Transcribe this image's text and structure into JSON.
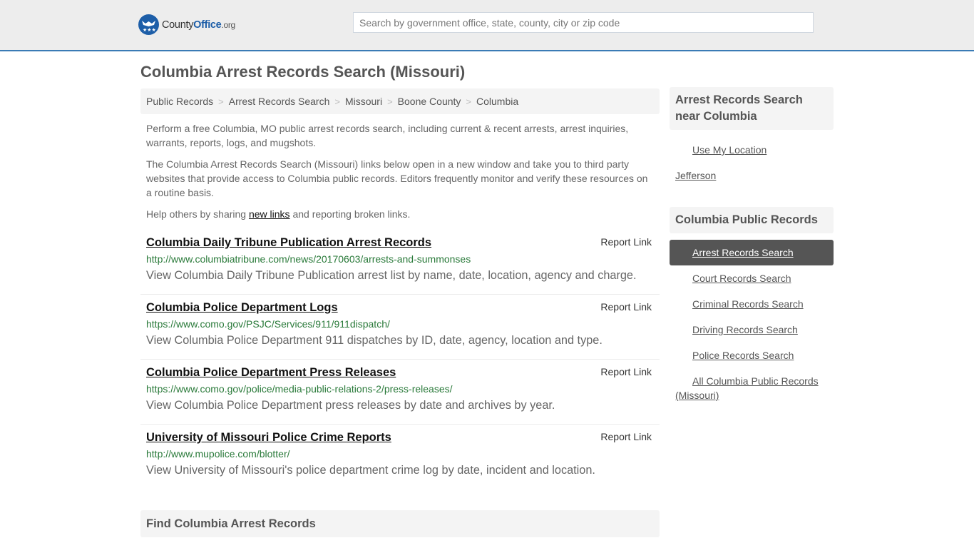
{
  "header": {
    "logo": {
      "county": "County",
      "office": "Office",
      "org": ".org",
      "icon": "eagle-stars-icon",
      "brand_color": "#1d5ea8"
    },
    "search_placeholder": "Search by government office, state, county, city or zip code",
    "accent_color": "#3a7bb5"
  },
  "page_title": "Columbia Arrest Records Search (Missouri)",
  "breadcrumb": [
    {
      "label": "Public Records"
    },
    {
      "label": "Arrest Records Search"
    },
    {
      "label": "Missouri"
    },
    {
      "label": "Boone County"
    },
    {
      "label": "Columbia"
    }
  ],
  "breadcrumb_separator": ">",
  "intro": {
    "p1": "Perform a free Columbia, MO public arrest records search, including current & recent arrests, arrest inquiries, warrants, reports, logs, and mugshots.",
    "p2": "The Columbia Arrest Records Search (Missouri) links below open in a new window and take you to third party websites that provide access to Columbia public records. Editors frequently monitor and verify these resources on a routine basis.",
    "p3_before": "Help others by sharing ",
    "p3_link": "new links",
    "p3_after": " and reporting broken links."
  },
  "links": [
    {
      "title": "Columbia Daily Tribune Publication Arrest Records",
      "report": "Report Link",
      "url": "http://www.columbiatribune.com/news/20170603/arrests-and-summonses",
      "desc": "View Columbia Daily Tribune Publication arrest list by name, date, location, agency and charge."
    },
    {
      "title": "Columbia Police Department Logs",
      "report": "Report Link",
      "url": "https://www.como.gov/PSJC/Services/911/911dispatch/",
      "desc": "View Columbia Police Department 911 dispatches by ID, date, agency, location and type."
    },
    {
      "title": "Columbia Police Department Press Releases",
      "report": "Report Link",
      "url": "https://www.como.gov/police/media-public-relations-2/press-releases/",
      "desc": "View Columbia Police Department press releases by date and archives by year."
    },
    {
      "title": "University of Missouri Police Crime Reports",
      "report": "Report Link",
      "url": "http://www.mupolice.com/blotter/",
      "desc": "View University of Missouri's police department crime log by date, incident and location."
    }
  ],
  "find_section": {
    "heading": "Find Columbia Arrest Records"
  },
  "sidebar": {
    "near": {
      "heading": "Arrest Records Search near Columbia",
      "use_location": "Use My Location",
      "cities": [
        "Jefferson"
      ]
    },
    "public_records": {
      "heading": "Columbia Public Records",
      "items": [
        {
          "label": "Arrest Records Search",
          "active": true
        },
        {
          "label": "Court Records Search"
        },
        {
          "label": "Criminal Records Search"
        },
        {
          "label": "Driving Records Search"
        },
        {
          "label": "Police Records Search"
        },
        {
          "label": "All Columbia Public Records (Missouri)"
        }
      ]
    }
  }
}
